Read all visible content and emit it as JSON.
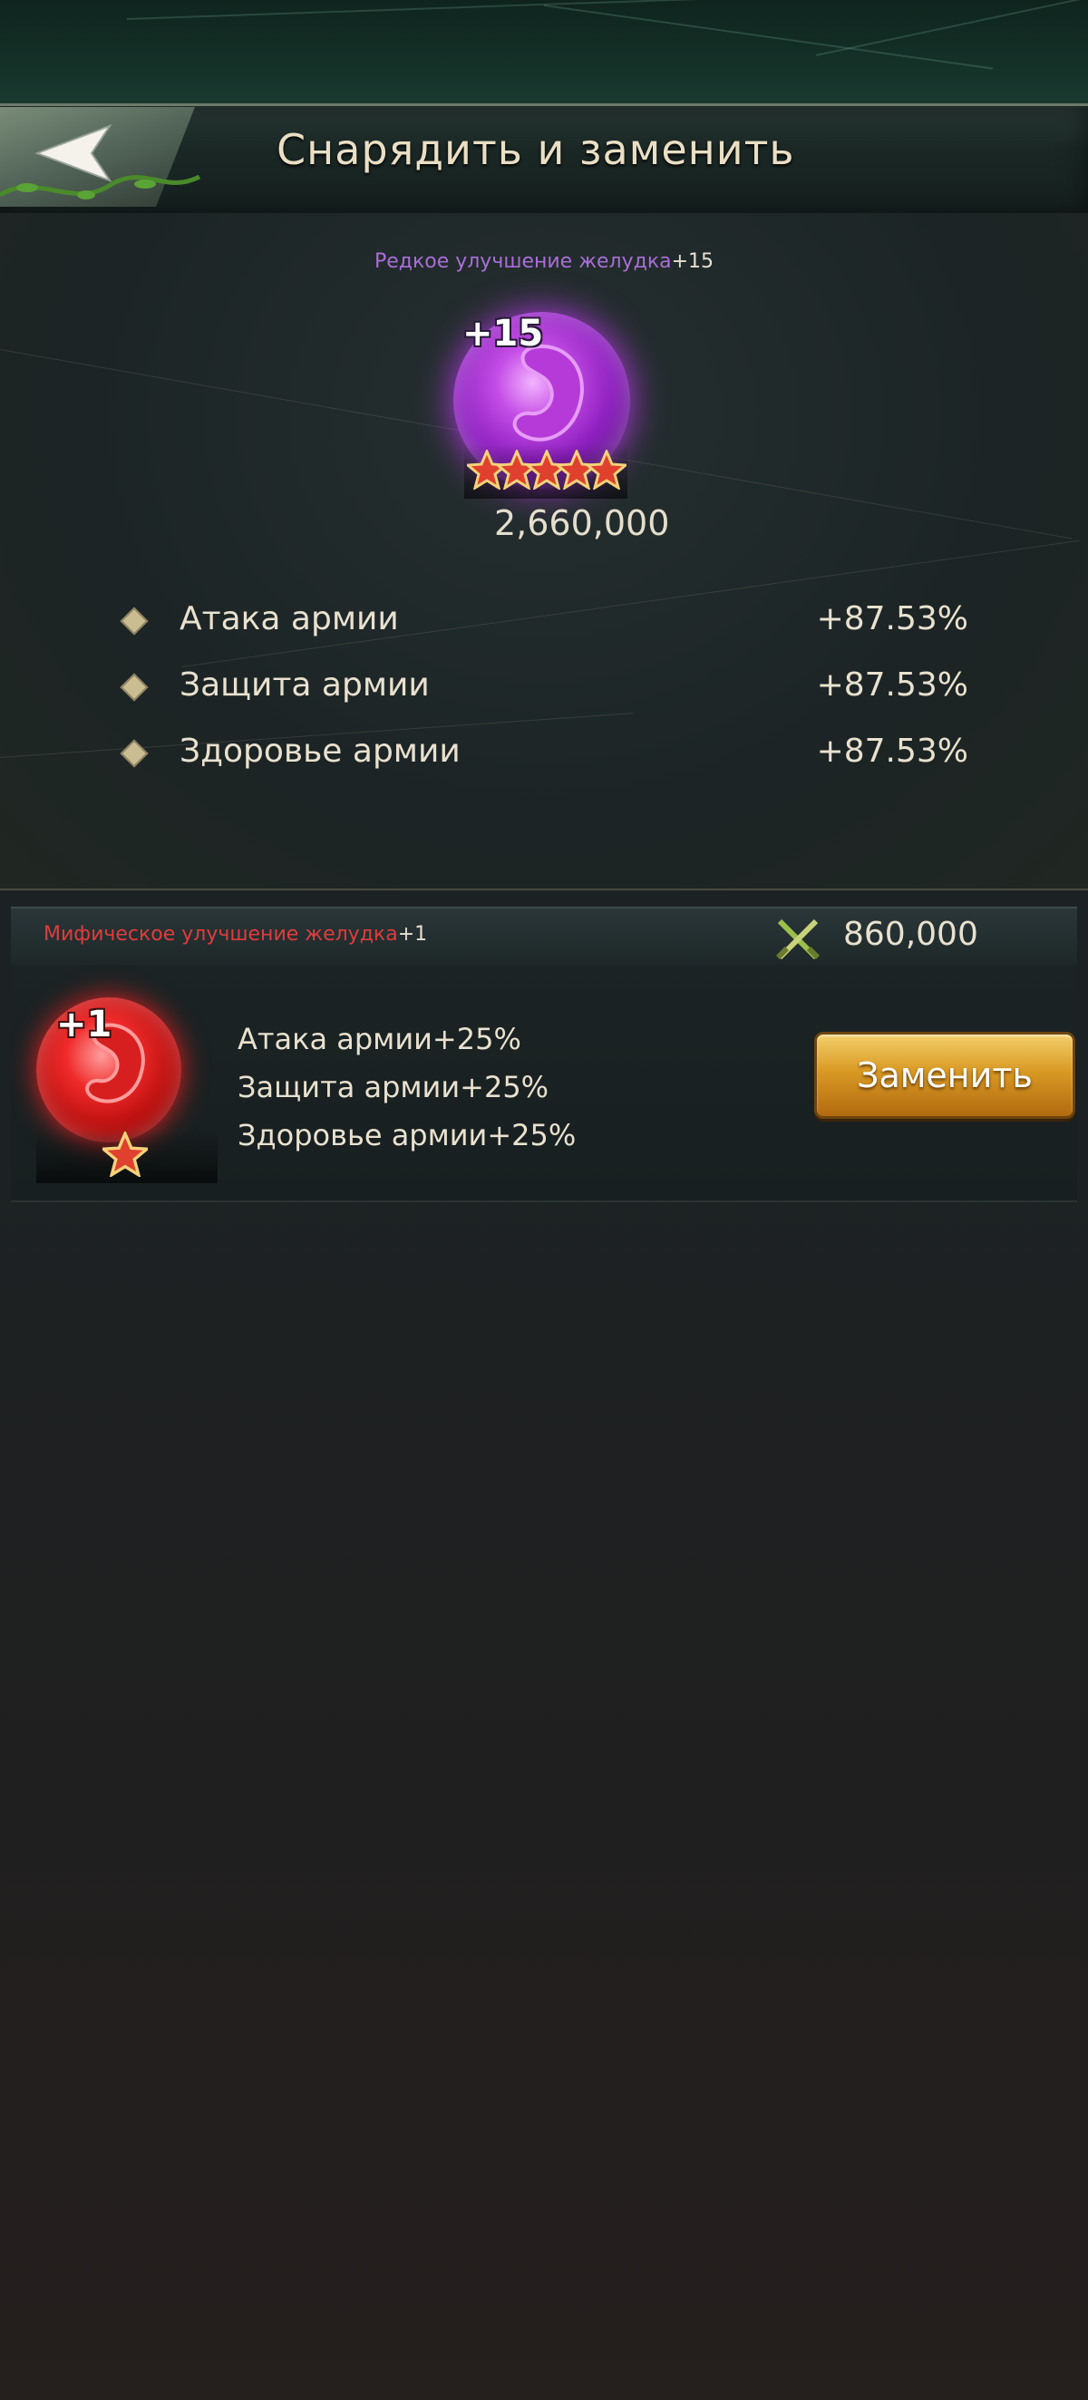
{
  "header": {
    "title": "Снарядить и заменить"
  },
  "equipped": {
    "name": "Редкое улучшение желудка",
    "level_suffix": "+15",
    "icon_label": "+15",
    "stars": 5,
    "power": "2,660,000",
    "stats": [
      {
        "name": "Атака армии",
        "value": "+87.53%"
      },
      {
        "name": "Защита армии",
        "value": "+87.53%"
      },
      {
        "name": "Здоровье армии",
        "value": "+87.53%"
      }
    ]
  },
  "candidate": {
    "name": "Мифическое улучшение желудка",
    "level_suffix": "+1",
    "icon_label": "+1",
    "stars": 1,
    "power": "860,000",
    "bonuses": [
      "Атака армии+25%",
      "Защита армии+25%",
      "Здоровье армии+25%"
    ],
    "replace_label": "Заменить"
  },
  "colors": {
    "rare": "#a96ed8",
    "mythic": "#e03c3c",
    "button_gold": "#d99a24"
  },
  "icons": {
    "back": "back-arrow-icon",
    "power": "crossed-swords-icon",
    "star": "star-icon",
    "bullet": "diamond-bullet-icon"
  }
}
